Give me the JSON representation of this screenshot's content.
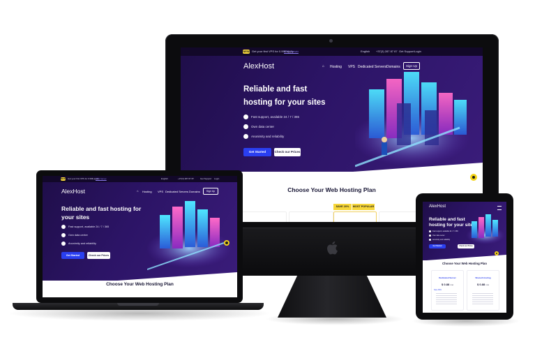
{
  "site": {
    "promo_badge": "NEW",
    "promo_text": "Get your first VPS for 0.99$ apply",
    "promo_link": "VPS Server",
    "language": "English",
    "phone": "+37(3) 287 87 87",
    "get_support": "Get Support",
    "login": "Login",
    "logo_mark": "A",
    "logo_text": "lexHost",
    "nav": {
      "home_icon": "home-icon",
      "hosting": "Hosting",
      "vps": "VPS",
      "dedicated": "Dedicated Servers",
      "domains": "Domains",
      "signup": "Sign Up"
    },
    "hero_title_line1": "Reliable and fast",
    "hero_title_line2": "hosting for your sites",
    "hero_title_lap_1": "Reliable and fast hosting for",
    "hero_title_lap_2": "your sites",
    "features": [
      "Fast support, available 24 / 7 / 365",
      "Own data center",
      "Anonimity and reliability"
    ],
    "get_started": "Get Started",
    "check_prices": "Check our Prices",
    "section_title": "Choose Your Web Hosting Plan",
    "save_badge": "SAVE 20%",
    "most_popular": "MOST POPULAR"
  },
  "tablet": {
    "plans": [
      {
        "name": "Dedicated Server",
        "price": "$ 0.88",
        "per": "/ mo",
        "cta": "Save 80%"
      },
      {
        "name": "Shared Hosting",
        "price": "$ 0.88",
        "per": "/ mo",
        "cta": ""
      }
    ]
  },
  "colors": {
    "hero_dark": "#1f0e49",
    "accent_blue": "#2a3ff0",
    "badge_yellow": "#f6d63a",
    "server_cyan": "#3fd8ff",
    "server_pink": "#ff4fb0"
  }
}
